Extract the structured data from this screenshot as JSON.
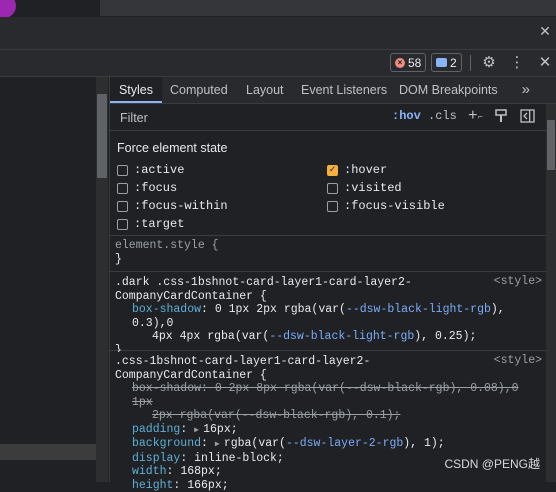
{
  "toolbar": {
    "errors_count": "58",
    "messages_count": "2",
    "settings_icon": "gear-icon",
    "more_icon": "vertical-dots-icon",
    "close_icon": "close-icon"
  },
  "tabs": [
    "Styles",
    "Computed",
    "Layout",
    "Event Listeners",
    "DOM Breakpoints"
  ],
  "tabs_more": "»",
  "filter": {
    "placeholder": "Filter",
    "hov": ":hov",
    "cls": ".cls",
    "plus": "+"
  },
  "force_state": {
    "title": "Force element state",
    "states": [
      {
        "label": ":active",
        "checked": false
      },
      {
        "label": ":hover",
        "checked": true
      },
      {
        "label": ":focus",
        "checked": false
      },
      {
        "label": ":visited",
        "checked": false
      },
      {
        "label": ":focus-within",
        "checked": false
      },
      {
        "label": ":focus-visible",
        "checked": false
      },
      {
        "label": ":target",
        "checked": false
      }
    ]
  },
  "rules": {
    "element_style": {
      "selector": "element.style {",
      "close": "}"
    },
    "rule1": {
      "selector_line1": ".dark .css-1bshnot-card-layer1-card-layer2-",
      "selector_line2": "CompanyCardContainer {",
      "source": "<style>",
      "prop": "box-shadow",
      "val_a": ": 0 1px 2px rgba(var(",
      "var_a": "--dsw-black-light-rgb",
      "val_b": "), 0.3),0",
      "val_c": "4px 4px rgba(var(",
      "var_b": "--dsw-black-light-rgb",
      "val_d": "), 0.25);",
      "close": "}"
    },
    "rule2": {
      "selector_line1": ".css-1bshnot-card-layer1-card-layer2-",
      "selector_line2": "CompanyCardContainer {",
      "source": "<style>",
      "shadow_prop": "box-shadow",
      "shadow_a": ": 0 2px 8px rgba(var(",
      "shadow_var_a": "--dsw-black-rgb",
      "shadow_b": "), 0.08),0 1px",
      "shadow_c": "2px rgba(var(",
      "shadow_var_b": "--dsw-black-rgb",
      "shadow_d": "), 0.1);",
      "padding_prop": "padding",
      "padding_val": "16px;",
      "bg_prop": "background",
      "bg_a": "rgba(var(",
      "bg_var": "--dsw-layer-2-rgb",
      "bg_b": "), 1);",
      "display_prop": "display",
      "display_val": ": inline-block;",
      "width_prop": "width",
      "width_val": ": 168px;",
      "height_prop": "height",
      "height_val": ": 166px;"
    }
  },
  "watermark": "CSDN @PENG越"
}
